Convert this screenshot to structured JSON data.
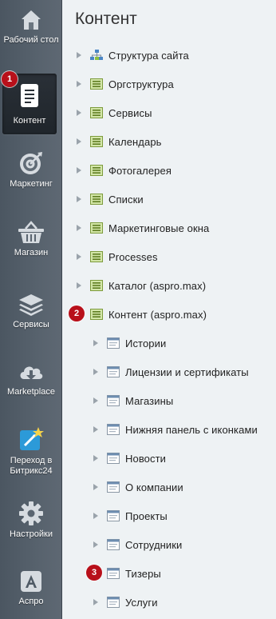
{
  "sidebar": {
    "items": [
      {
        "label": "Рабочий стол",
        "icon": "home-icon"
      },
      {
        "label": "Контент",
        "icon": "document-icon",
        "active": true
      },
      {
        "label": "Маркетинг",
        "icon": "target-icon"
      },
      {
        "label": "Магазин",
        "icon": "basket-icon"
      },
      {
        "label": "Сервисы",
        "icon": "layers-icon"
      },
      {
        "label": "Marketplace",
        "icon": "cloud-download-icon"
      },
      {
        "label": "Переход в Битрикс24",
        "icon": "bitrix24-icon"
      },
      {
        "label": "Настройки",
        "icon": "gear-icon"
      },
      {
        "label": "Аспро",
        "icon": "letter-a-icon"
      }
    ]
  },
  "badges": [
    "1",
    "2",
    "3"
  ],
  "main": {
    "title": "Контент",
    "tree": [
      {
        "label": "Структура сайта",
        "icon": "site-structure-icon",
        "level": 0
      },
      {
        "label": "Оргструктура",
        "icon": "list-icon",
        "level": 0
      },
      {
        "label": "Сервисы",
        "icon": "list-icon",
        "level": 0
      },
      {
        "label": "Календарь",
        "icon": "list-icon",
        "level": 0
      },
      {
        "label": "Фотогалерея",
        "icon": "list-icon",
        "level": 0
      },
      {
        "label": "Списки",
        "icon": "list-icon",
        "level": 0
      },
      {
        "label": "Маркетинговые окна",
        "icon": "list-icon",
        "level": 0
      },
      {
        "label": "Processes",
        "icon": "list-icon",
        "level": 0
      },
      {
        "label": "Каталог (aspro.max)",
        "icon": "list-icon",
        "level": 0
      },
      {
        "label": "Контент (aspro.max)",
        "icon": "list-icon",
        "level": 0
      },
      {
        "label": "Истории",
        "icon": "infoblock-icon",
        "level": 1
      },
      {
        "label": "Лицензии и сертификаты",
        "icon": "infoblock-icon",
        "level": 1
      },
      {
        "label": "Магазины",
        "icon": "infoblock-icon",
        "level": 1
      },
      {
        "label": "Нижняя панель с иконками",
        "icon": "infoblock-icon",
        "level": 1
      },
      {
        "label": "Новости",
        "icon": "infoblock-icon",
        "level": 1
      },
      {
        "label": "О компании",
        "icon": "infoblock-icon",
        "level": 1
      },
      {
        "label": "Проекты",
        "icon": "infoblock-icon",
        "level": 1
      },
      {
        "label": "Сотрудники",
        "icon": "infoblock-icon",
        "level": 1
      },
      {
        "label": "Тизеры",
        "icon": "infoblock-icon",
        "level": 1
      },
      {
        "label": "Услуги",
        "icon": "infoblock-icon",
        "level": 1
      }
    ]
  },
  "colors": {
    "sidebar": "#56616c",
    "active": "#23292f",
    "badge": "#b8101a",
    "content_bg": "#eef2f4"
  }
}
